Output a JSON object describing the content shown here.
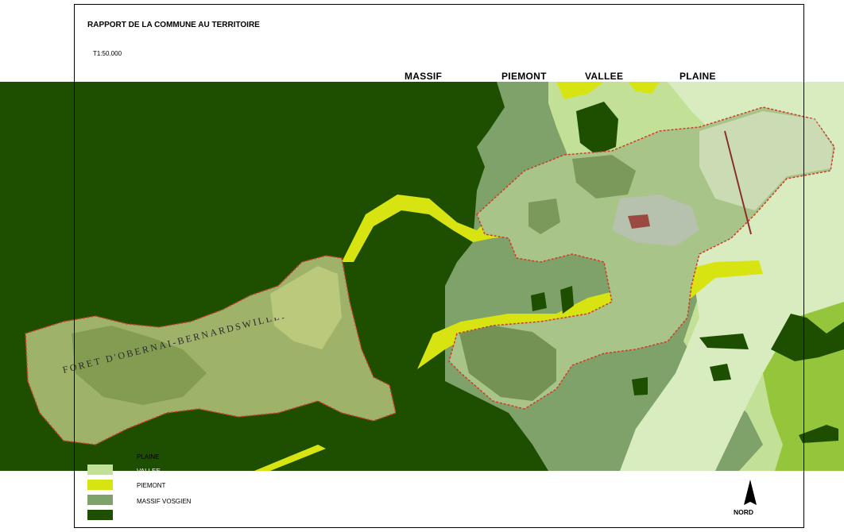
{
  "header": {
    "title": "RAPPORT DE LA COMMUNE AU TERRITOIRE",
    "scale": "T1:50.000"
  },
  "zones": {
    "massif": "MASSIF",
    "piemont": "PIEMONT",
    "vallee": "VALLEE",
    "plaine": "PLAINE"
  },
  "map_labels": {
    "forest": "FORET D'OBERNAI-BERNARDSWILLER"
  },
  "legend": [
    {
      "label": "PLAINE",
      "color": "#ffffff"
    },
    {
      "label": "VALLEE",
      "color": "#c3e097"
    },
    {
      "label": "PIEMONT",
      "color": "#d8e412"
    },
    {
      "label": "MASSIF VOSGIEN",
      "color": "#7ea26a"
    },
    {
      "label": "",
      "color": "#1e4f01"
    }
  ],
  "north": {
    "label": "NORD"
  },
  "colors": {
    "massif_dark": "#1e4f01",
    "massif_vosgien": "#7ea26a",
    "piemont": "#d8e412",
    "vallee": "#c3e097",
    "plaine_bright": "#94c53b",
    "boundary": "#d23a2a"
  }
}
